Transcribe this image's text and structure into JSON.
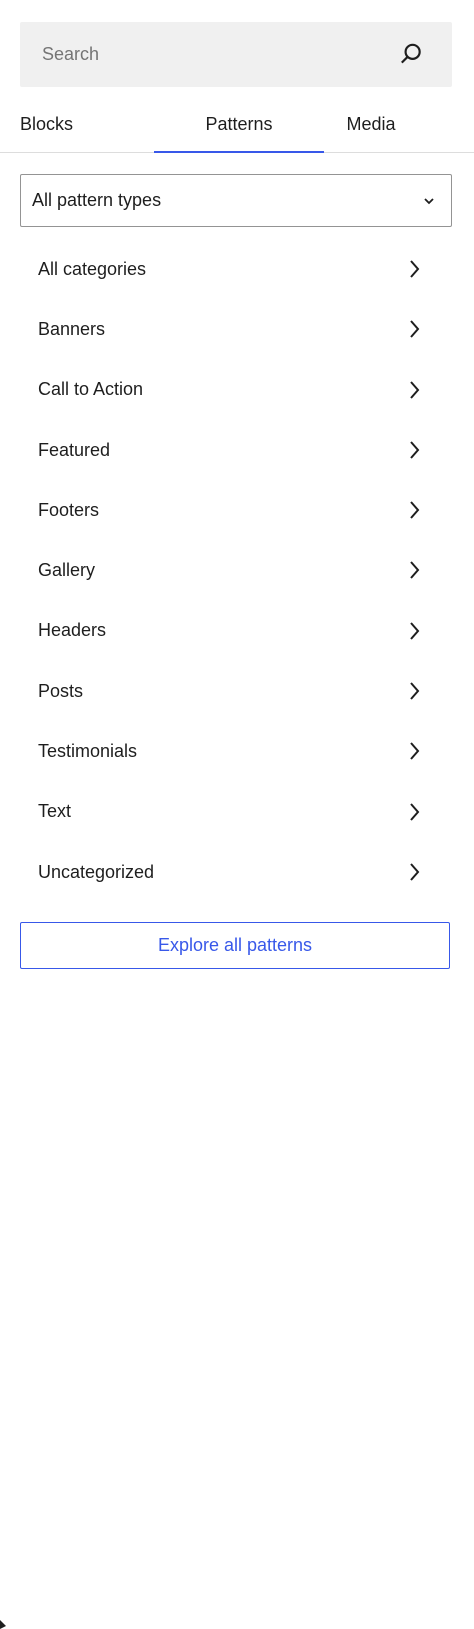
{
  "search": {
    "placeholder": "Search",
    "icon": "search-icon"
  },
  "tabs": [
    {
      "label": "Blocks",
      "selected": false
    },
    {
      "label": "Patterns",
      "selected": true
    },
    {
      "label": "Media",
      "selected": false
    }
  ],
  "pattern_type_select": {
    "selected": "All pattern types",
    "icon": "chevron-down-icon"
  },
  "categories": [
    {
      "label": "All categories"
    },
    {
      "label": "Banners"
    },
    {
      "label": "Call to Action"
    },
    {
      "label": "Featured"
    },
    {
      "label": "Footers"
    },
    {
      "label": "Gallery"
    },
    {
      "label": "Headers"
    },
    {
      "label": "Posts"
    },
    {
      "label": "Testimonials"
    },
    {
      "label": "Text"
    },
    {
      "label": "Uncategorized"
    }
  ],
  "explore_button": {
    "label": "Explore all patterns"
  },
  "colors": {
    "accent": "#3858e9",
    "text": "#1e1e1e",
    "search_bg": "#f0f0f0",
    "placeholder": "#757575",
    "divider": "#dddddd"
  }
}
